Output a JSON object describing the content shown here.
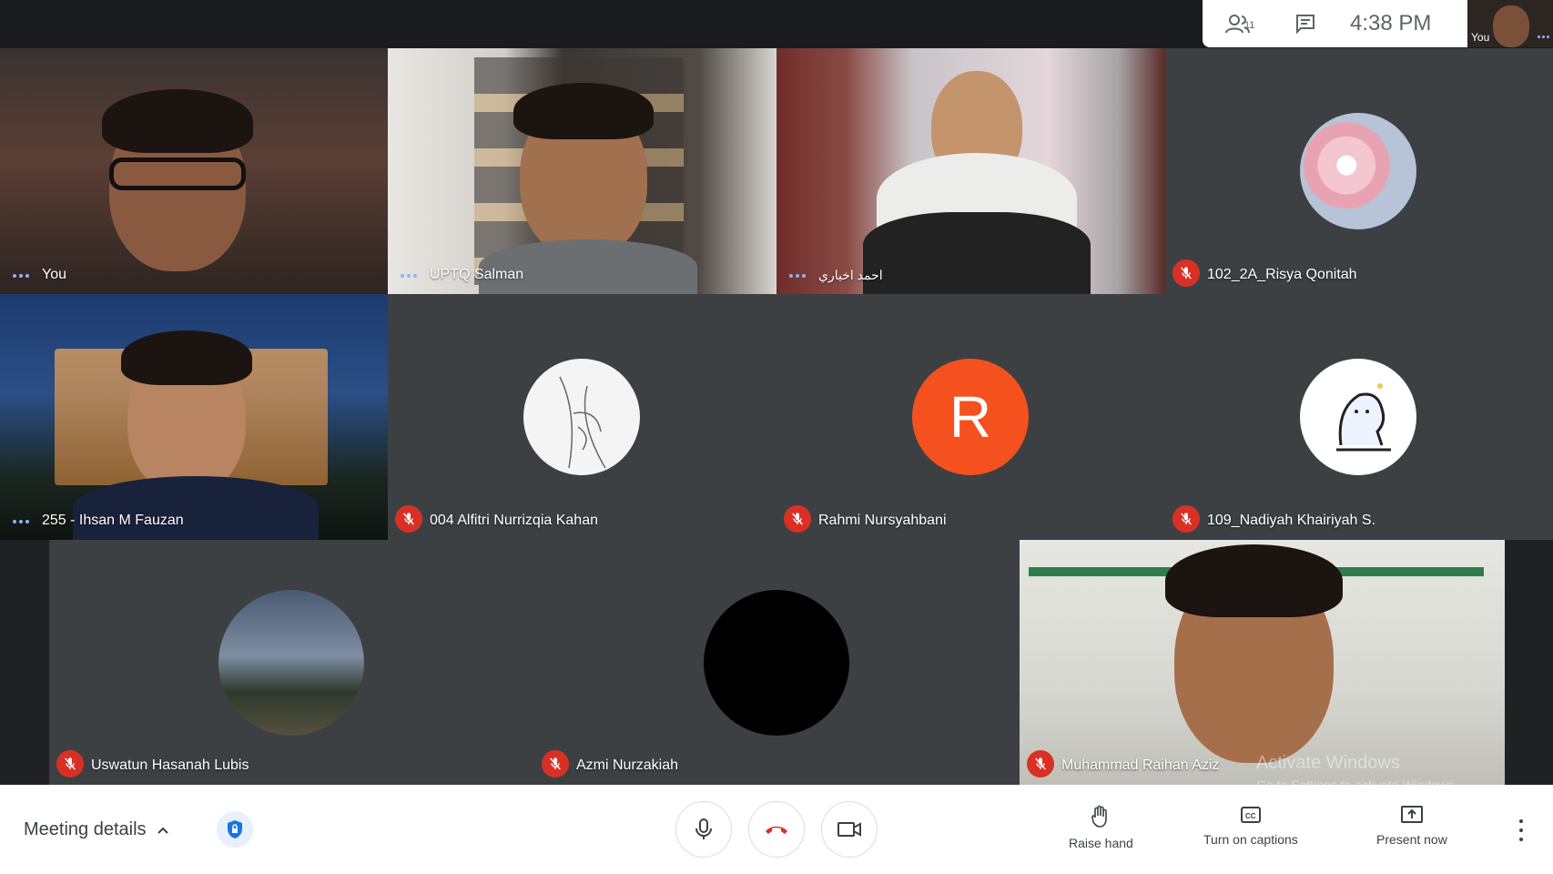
{
  "top": {
    "participants_count": "11",
    "clock": "4:38  PM",
    "self_thumb_label": "You"
  },
  "tiles": [
    {
      "name": "You"
    },
    {
      "name": "UPTQ Salman"
    },
    {
      "name": "احمد اخياري"
    },
    {
      "name": "102_2A_Risya Qonitah"
    },
    {
      "name": "255 - Ihsan M Fauzan"
    },
    {
      "name": "004 Alfitri Nurrizqia Kahan"
    },
    {
      "name": "Rahmi Nursyahbani",
      "initial": "R"
    },
    {
      "name": "109_Nadiyah Khairiyah S."
    },
    {
      "name": "Uswatun Hasanah Lubis"
    },
    {
      "name": "Azmi Nurzakiah"
    },
    {
      "name": "Muhammad Raihan Aziz"
    }
  ],
  "bottom": {
    "meeting_details": "Meeting details",
    "raise_hand": "Raise hand",
    "captions": "Turn on captions",
    "present": "Present now"
  },
  "watermark": {
    "title": "Activate Windows",
    "sub": "Go to Settings to activate Windows."
  },
  "colors": {
    "speaking": "#3ce0d0",
    "mute": "#d93025",
    "avatar_r": "#f4511e",
    "hangup": "#d93025"
  },
  "icons": [
    "people-icon",
    "chat-icon",
    "mic-icon",
    "hangup-icon",
    "camera-icon",
    "hand-icon",
    "captions-icon",
    "present-icon",
    "more-icon",
    "shield-icon"
  ]
}
